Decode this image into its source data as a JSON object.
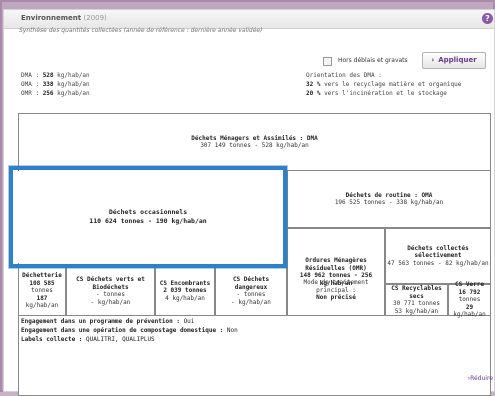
{
  "header": {
    "title": "Environnement",
    "year": "(2009)",
    "help": "?"
  },
  "subtitle": "Synthèse des quantités collectées (année de référence : dernière année validée)",
  "controls": {
    "checkbox_label": "Hors déblais et gravats",
    "apply_label": "Appliquer",
    "apply_chevron": "›"
  },
  "summary": {
    "dma_label": "DMA : ",
    "dma_value": "528",
    "dma_unit": " kg/hab/an",
    "omr_label": "OMA : ",
    "oma_value": "338",
    "oma_unit": " kg/hab/an",
    "omr2_label": "OMR : ",
    "omr_value": "256",
    "omr_unit": " kg/hab/an"
  },
  "orientation": {
    "title": "Orientation des DMA :",
    "line1_pct": "32 %",
    "line1_text": " vers le recyclage matière et organique",
    "line2_pct": "20 %",
    "line2_text": " vers l'incinération et le stockage"
  },
  "dma_box": {
    "title": "Déchets Ménagers et Assimilés : DMA",
    "value": "307 149 tonnes - 528 kg/hab/an"
  },
  "routine_box": {
    "title": "Déchets de routine : OMA",
    "value": "196 525 tonnes - 338 kg/hab/an"
  },
  "occasionnels": {
    "title": "Déchets occasionnels",
    "value": "110 624 tonnes - 190 kg/hab/an"
  },
  "omr_box": {
    "title": "Ordures Ménagères Résiduelles (OMR)",
    "value": "148 962 tonnes - 256 kg/hab/an",
    "traitement_label": "Mode de traitement principal :",
    "traitement_value": "Non précisé"
  },
  "collect_box": {
    "title": "Déchets collectés sélectivement",
    "value": "47 563 tonnes - 82 kg/hab/an"
  },
  "small_cells": [
    {
      "title": "Déchetterie",
      "l1": "108 585",
      "l2": "tonnes",
      "l3": "187",
      "l4": "kg/hab/an"
    },
    {
      "title": "CS Déchets verts et Biodéchets",
      "l1": "- tonnes",
      "l2": "- kg/hab/an",
      "l3": "",
      "l4": ""
    },
    {
      "title": "CS Encombrants",
      "l1": "2 039 tonnes",
      "l2": "4 kg/hab/an",
      "l3": "",
      "l4": ""
    },
    {
      "title": "CS Déchets dangereux",
      "l1": "- tonnes",
      "l2": "- kg/hab/an",
      "l3": "",
      "l4": ""
    },
    {
      "title": "CS Recyclables secs",
      "l1": "30 771 tonnes",
      "l2": "53 kg/hab/an",
      "l3": "",
      "l4": ""
    },
    {
      "title": "CS Verre",
      "l1": "16 792",
      "l2": "tonnes",
      "l3": "29",
      "l4": "kg/hab/an"
    }
  ],
  "footer": {
    "line1_label": "Engagement dans un programme de prévention : ",
    "line1_value": "Oui",
    "line2_label": "Engagement dans une opération de compostage domestique : ",
    "line2_value": "Non",
    "line3_label": "Labels collecte : ",
    "line3_value": "QUALITRI, QUALIPLUS",
    "reduire": "Réduire",
    "reduire_chevron": "›"
  },
  "colors": {
    "accent": "#6a3a8a",
    "highlight": "#2f80c8",
    "frame": "#c7b2c7"
  }
}
